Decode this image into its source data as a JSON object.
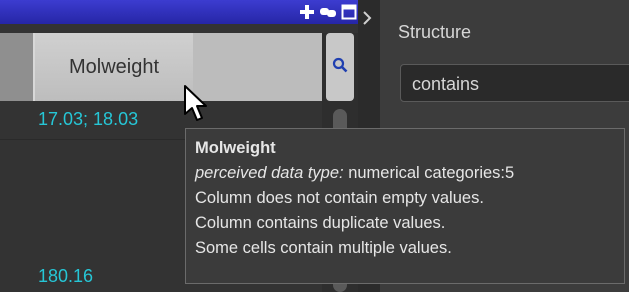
{
  "table": {
    "column_header": "Molweight",
    "cells": [
      "17.03; 18.03",
      "180.16"
    ]
  },
  "right_panel": {
    "structure_label": "Structure",
    "contains_value": "contains"
  },
  "tooltip": {
    "title": "Molweight",
    "type_prefix": "perceived data type:",
    "type_value": " numerical categories:5",
    "lines": [
      "Column does not contain empty values.",
      "Column contains duplicate values.",
      "Some cells contain multiple values."
    ]
  },
  "colors": {
    "titlebar": "#2a2ab0",
    "cell_text": "#26c6d6",
    "tooltip_bg": "#3b3b3b"
  },
  "icons": [
    "plus-icon",
    "link-icon",
    "window-icon",
    "chevron-right-icon",
    "search-icon",
    "mouse-pointer-icon"
  ]
}
